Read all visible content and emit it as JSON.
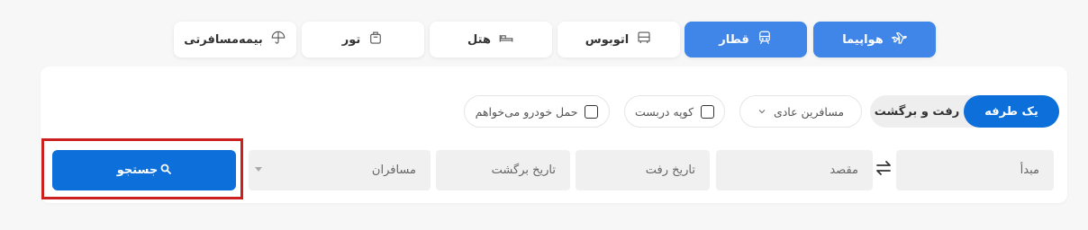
{
  "tabs": [
    {
      "label": "هواپیما",
      "icon": "airplane-icon",
      "active": true
    },
    {
      "label": "قطار",
      "icon": "train-icon",
      "active": true
    },
    {
      "label": "اتوبوس",
      "icon": "bus-icon",
      "active": false
    },
    {
      "label": "هتل",
      "icon": "bed-icon",
      "active": false
    },
    {
      "label": "تور",
      "icon": "suitcase-icon",
      "active": false
    },
    {
      "label": "بیمه‌مسافرتی",
      "icon": "umbrella-icon",
      "active": false
    }
  ],
  "trip_type": {
    "one_way": "یک طرفه",
    "round_trip": "رفت و برگشت",
    "selected": "one_way"
  },
  "options": {
    "passenger_type": "مسافرین عادی",
    "exclusive_compartment": "کوپه دربست",
    "car_transport": "حمل خودرو می‌خواهم"
  },
  "fields": {
    "origin": "مبدأ",
    "destination": "مقصد",
    "departure_date": "تاریخ رفت",
    "return_date": "تاریخ برگشت",
    "passengers": "مسافران"
  },
  "search_label": "جستجو",
  "colors": {
    "primary": "#0d6fd9",
    "active_tab": "#3f86e8",
    "highlight": "#cc1f1f"
  }
}
